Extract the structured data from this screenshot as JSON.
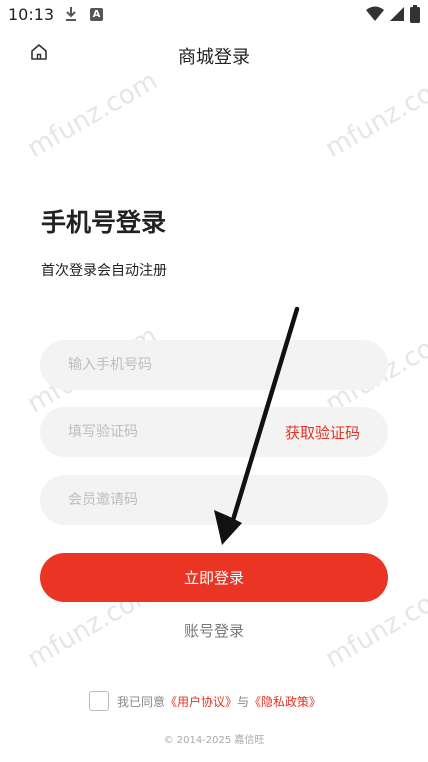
{
  "status": {
    "time": "10:13",
    "icons": [
      "download-icon",
      "a-icon",
      "wifi-icon",
      "signal-icon",
      "battery-icon"
    ]
  },
  "header": {
    "title": "商城登录",
    "home_icon": "home-icon"
  },
  "watermark_text": "mfunz.com",
  "login": {
    "heading": "手机号登录",
    "subheading": "首次登录会自动注册",
    "phone_placeholder": "输入手机号码",
    "code_placeholder": "填写验证码",
    "get_code_label": "获取验证码",
    "invite_placeholder": "会员邀请码",
    "submit_label": "立即登录",
    "account_login_label": "账号登录"
  },
  "agreement": {
    "prefix": "我已同意",
    "user_agreement": "《用户协议》",
    "joiner": "与",
    "privacy_policy": "《隐私政策》"
  },
  "footer": {
    "copyright": "© 2014-2025 嘉信旺"
  },
  "colors": {
    "accent": "#ea3424",
    "field_bg": "#f3f3f3"
  }
}
